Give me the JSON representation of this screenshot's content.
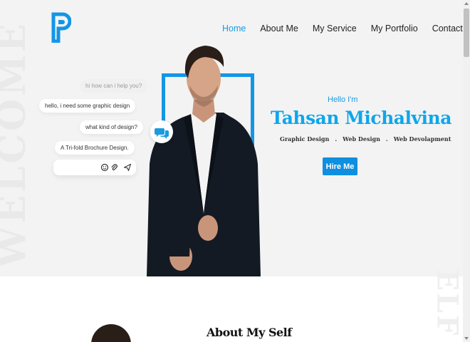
{
  "hero": {
    "watermark": "WELCOME",
    "greeting": "Hello I'm",
    "name": "Tahsan Michalvina",
    "skills": [
      "Graphic Design",
      ".",
      "Web Design",
      ".",
      "Web Devolapment"
    ],
    "hire_label": "Hire Me"
  },
  "nav": {
    "items": [
      "Home",
      "About Me",
      "My Service",
      "My Portfolio",
      "Contact"
    ],
    "active": "Home"
  },
  "chat": {
    "messages": [
      "hi how can i help you?",
      "hello, i need some graphic design",
      "what kind of design?",
      "A Tri-fold Brochure Design."
    ],
    "input_placeholder": ""
  },
  "about": {
    "watermark": "ELF",
    "title": "About My Self"
  },
  "colors": {
    "accent": "#1396e6",
    "name_color": "#0fa6ea",
    "hero_bg": "#f3f3f3"
  },
  "icons": [
    "logo-p-icon",
    "chat-bubbles-icon",
    "emoji-icon",
    "attachment-icon",
    "send-icon"
  ]
}
